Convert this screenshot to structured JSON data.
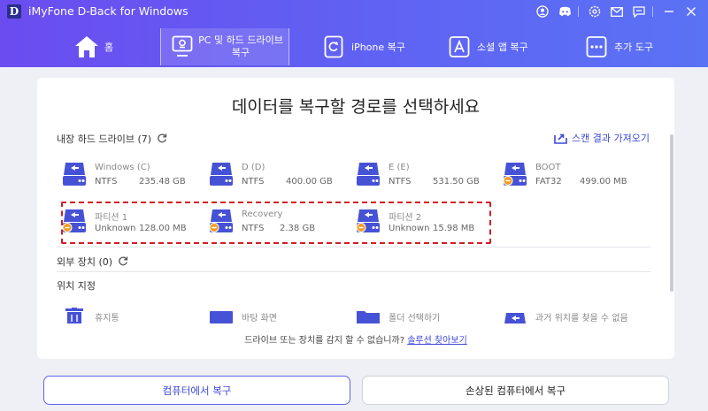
{
  "app": {
    "logo": "D",
    "title": "iMyFone D-Back for Windows"
  },
  "titlebar_icons": [
    "user-icon",
    "discord-icon",
    "settings-icon",
    "mail-icon",
    "feedback-icon",
    "minimize-icon",
    "close-icon"
  ],
  "nav": {
    "tabs": [
      {
        "label": "홈",
        "icon": "home-icon"
      },
      {
        "label": "PC 및 하드 드라이브 복구",
        "icon": "pc-drive-icon",
        "active": true
      },
      {
        "label": "iPhone 복구",
        "icon": "iphone-recovery-icon"
      },
      {
        "label": "소셜 앱 복구",
        "icon": "social-app-icon"
      },
      {
        "label": "추가 도구",
        "icon": "more-tools-icon"
      }
    ]
  },
  "main": {
    "title": "데이터를 복구할 경로를 선택하세요",
    "import_scan_label": "스캔 결과 가져오기",
    "internal": {
      "title": "내장 하드 드라이브 (7)",
      "drives": [
        {
          "name": "Windows (C)",
          "fs": "NTFS",
          "size": "235.48 GB",
          "badge": false
        },
        {
          "name": "D (D)",
          "fs": "NTFS",
          "size": "400.00 GB",
          "badge": false
        },
        {
          "name": "E (E)",
          "fs": "NTFS",
          "size": "531.50 GB",
          "badge": false
        },
        {
          "name": "BOOT",
          "fs": "FAT32",
          "size": "499.00 MB",
          "badge": true
        },
        {
          "name": "파티션 1",
          "fs": "Unknown",
          "size": "128.00 MB",
          "badge": true
        },
        {
          "name": "Recovery",
          "fs": "NTFS",
          "size": "2.38 GB",
          "badge": true
        },
        {
          "name": "파티션 2",
          "fs": "Unknown",
          "size": "15.98 MB",
          "badge": true
        }
      ]
    },
    "external": {
      "title": "외부 장치 (0)"
    },
    "locations": {
      "title": "위치 지정",
      "items": [
        {
          "label": "휴지통",
          "icon": "trash-icon"
        },
        {
          "label": "바탕 화면",
          "icon": "desktop-icon"
        },
        {
          "label": "폴더 선택하기",
          "icon": "folder-icon"
        },
        {
          "label": "과거 위치를 찾을 수 없음",
          "icon": "lost-location-icon"
        }
      ]
    },
    "help": {
      "text": "드라이브 또는 장치를 감지 할 수 없습니까?",
      "link": "솔루션 찾아보기"
    }
  },
  "bottom": {
    "primary": "컴퓨터에서 복구",
    "secondary": "손상된 컴퓨터에서 복구"
  },
  "colors": {
    "accent": "#5c63e8",
    "header_start": "#6b4cf0",
    "header_end": "#5a72f4",
    "drive_icon": "#4652d6",
    "badge": "#f39c1f",
    "highlight": "#d21e26"
  }
}
